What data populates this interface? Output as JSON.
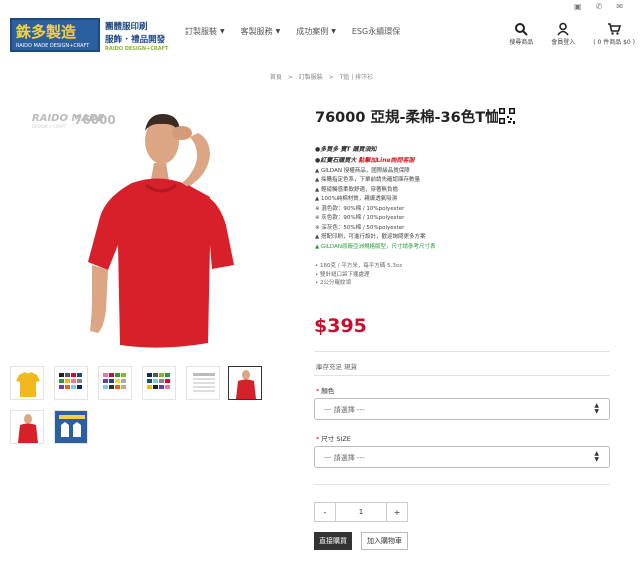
{
  "topbar": {
    "icon_1": "image-icon",
    "icon_2": "phone-icon",
    "icon_3": "mail-icon"
  },
  "logo": {
    "main": "銖多製造",
    "sub": "RAIDO MADE DESIGN+CRAFT"
  },
  "slogan": {
    "line1": "團體服印刷",
    "line2": "服飾 · 禮品開發",
    "line3": "RAIDO DESIGN+CRAFT"
  },
  "nav": [
    {
      "label": "訂製服裝"
    },
    {
      "label": "客製服務"
    },
    {
      "label": "成功案例"
    },
    {
      "label": "ESG永續環保"
    }
  ],
  "header_icons": {
    "search": "搜尋商品",
    "member": "會員登入",
    "cart": "( 0 件商品 $0 )"
  },
  "breadcrumb": [
    "首頁",
    "訂製服裝",
    "T恤 | 排汗衫"
  ],
  "product": {
    "brand": "RAIDO MADE",
    "brand_small": "DESIGN + CRAFT",
    "model": "76000",
    "title": "76000 亞規-柔棉-36色T恤",
    "tag1": "●多買多 賣T 購買須知",
    "tag2_prefix": "●紅寶石購買大 ",
    "tag2_red": "點擊加Line詢問客服",
    "features": [
      "▲ GILDAN 授權商品，國際級品質保障",
      "▲ 採購指定色系，下單前請先確認庫存數量",
      "▲ 輕磅觸感柔軟舒適，穿著無負擔",
      "▲ 100%純棉材質，親膚透氣吸濕",
      "※ 混色款：90%棉 / 10%polyester",
      "※ 灰色款：90%棉 / 10%polyester",
      "※ 深灰色：50%棉 / 50%polyester",
      "▲ 搭配印刷，可進行設計，歡迎詢問更多方案"
    ],
    "feature_green": "▲ GILDAN原廠亞洲規格版型，尺寸請參考尺寸表",
    "specs": [
      "• 180克 / 平方米，每平方碼 5.3oz",
      "• 雙針縫口袋下擺處理",
      "• 2公分羅紋領"
    ],
    "price": "$395",
    "stock_label": "庫存充足 現貨",
    "color_label": "顏色",
    "color_placeholder": "--- 請選擇 ---",
    "size_label": "尺寸 SIZE",
    "size_placeholder": "--- 請選擇 ---",
    "quantity": "1",
    "buy_label": "直接購買",
    "cart_label": "加入購物車"
  },
  "colors": {
    "shirt": "#d8202a",
    "price": "#c8102e",
    "accent": "#2b5fa0",
    "logo_yellow": "#f4d23a"
  }
}
